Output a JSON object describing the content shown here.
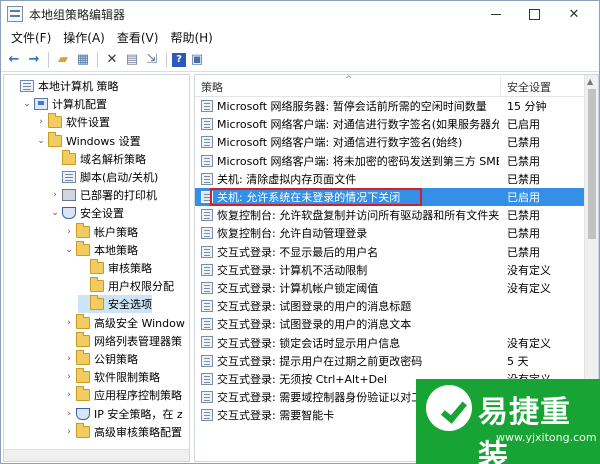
{
  "window": {
    "title": "本地组策略编辑器",
    "controls": {
      "close": "✕"
    }
  },
  "menu": [
    "文件(F)",
    "操作(A)",
    "查看(V)",
    "帮助(H)"
  ],
  "toolbar": {
    "icons": [
      "back-arrow-icon",
      "forward-arrow-icon",
      "up-folder-icon",
      "show-tree-icon",
      "delete-icon",
      "properties-icon",
      "export-icon",
      "help-icon",
      "view-icon"
    ]
  },
  "tree": {
    "items": [
      {
        "label": "本地计算机 策略",
        "level": 0,
        "expander": "",
        "icon": "policy"
      },
      {
        "label": "计算机配置",
        "level": 1,
        "expander": "⌄",
        "icon": "computer"
      },
      {
        "label": "软件设置",
        "level": 2,
        "expander": "›",
        "icon": "folder"
      },
      {
        "label": "Windows 设置",
        "level": 2,
        "expander": "⌄",
        "icon": "folder"
      },
      {
        "label": "域名解析策略",
        "level": 3,
        "expander": "",
        "icon": "folder"
      },
      {
        "label": "脚本(启动/关机)",
        "level": 3,
        "expander": "",
        "icon": "policy"
      },
      {
        "label": "已部署的打印机",
        "level": 3,
        "expander": "›",
        "icon": "printer"
      },
      {
        "label": "安全设置",
        "level": 3,
        "expander": "⌄",
        "icon": "shield"
      },
      {
        "label": "帐户策略",
        "level": 4,
        "expander": "›",
        "icon": "folder"
      },
      {
        "label": "本地策略",
        "level": 4,
        "expander": "⌄",
        "icon": "folder"
      },
      {
        "label": "审核策略",
        "level": 5,
        "expander": "",
        "icon": "folder"
      },
      {
        "label": "用户权限分配",
        "level": 5,
        "expander": "",
        "icon": "folder"
      },
      {
        "label": "安全选项",
        "level": 5,
        "expander": "",
        "icon": "folder",
        "selected": true
      },
      {
        "label": "高级安全 Window",
        "level": 4,
        "expander": "›",
        "icon": "folder"
      },
      {
        "label": "网络列表管理器策",
        "level": 4,
        "expander": "",
        "icon": "folder"
      },
      {
        "label": "公钥策略",
        "level": 4,
        "expander": "›",
        "icon": "folder"
      },
      {
        "label": "软件限制策略",
        "level": 4,
        "expander": "›",
        "icon": "folder"
      },
      {
        "label": "应用程序控制策略",
        "level": 4,
        "expander": "›",
        "icon": "folder"
      },
      {
        "label": "IP 安全策略，在 z",
        "level": 4,
        "expander": "›",
        "icon": "shield"
      },
      {
        "label": "高级审核策略配置",
        "level": 4,
        "expander": "›",
        "icon": "folder"
      }
    ]
  },
  "list": {
    "columns": {
      "policy": "策略",
      "setting": "安全设置"
    },
    "rows": [
      {
        "policy": "Microsoft 网络服务器: 暂停会话前所需的空闲时间数量",
        "setting": "15 分钟"
      },
      {
        "policy": "Microsoft 网络客户端: 对通信进行数字签名(如果服务器允...",
        "setting": "已启用"
      },
      {
        "policy": "Microsoft 网络客户端: 对通信进行数字签名(始终)",
        "setting": "已禁用"
      },
      {
        "policy": "Microsoft 网络客户端: 将未加密的密码发送到第三方 SMB...",
        "setting": "已禁用"
      },
      {
        "policy": "关机: 清除虚拟内存页面文件",
        "setting": "已禁用"
      },
      {
        "policy": "关机: 允许系统在未登录的情况下关闭",
        "setting": "已启用",
        "selected": true
      },
      {
        "policy": "恢复控制台: 允许软盘复制并访问所有驱动器和所有文件夹",
        "setting": "已禁用"
      },
      {
        "policy": "恢复控制台: 允许自动管理登录",
        "setting": "已禁用"
      },
      {
        "policy": "交互式登录: 不显示最后的用户名",
        "setting": "已禁用"
      },
      {
        "policy": "交互式登录: 计算机不活动限制",
        "setting": "没有定义"
      },
      {
        "policy": "交互式登录: 计算机帐户锁定阈值",
        "setting": "没有定义"
      },
      {
        "policy": "交互式登录: 试图登录的用户的消息标题",
        "setting": ""
      },
      {
        "policy": "交互式登录: 试图登录的用户的消息文本",
        "setting": ""
      },
      {
        "policy": "交互式登录: 锁定会话时显示用户信息",
        "setting": "没有定义"
      },
      {
        "policy": "交互式登录: 提示用户在过期之前更改密码",
        "setting": "5 天"
      },
      {
        "policy": "交互式登录: 无须按 Ctrl+Alt+Del",
        "setting": "没有定义"
      },
      {
        "policy": "交互式登录: 需要域控制器身份验证以对工作",
        "setting": ""
      },
      {
        "policy": "交互式登录: 需要智能卡",
        "setting": ""
      }
    ]
  },
  "watermark": {
    "text": "易捷重装",
    "url": "www.yjxitong.com",
    "color": "#18a435"
  }
}
